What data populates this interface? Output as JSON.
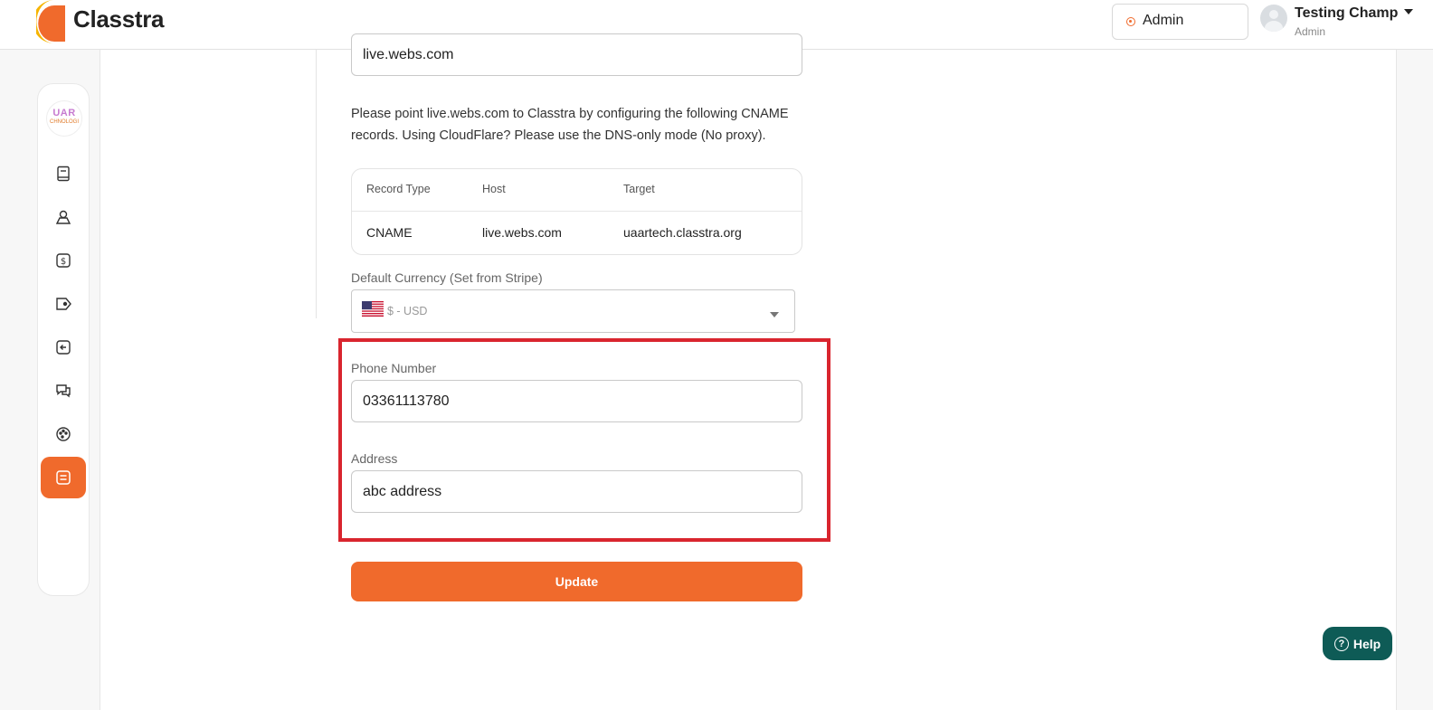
{
  "app": {
    "name": "Classtra"
  },
  "header": {
    "role_switch": {
      "label": "Admin"
    },
    "user": {
      "name": "Testing Champ",
      "role": "Admin"
    }
  },
  "sidebar": {
    "org_logo": {
      "line1": "UAR",
      "line2": "CHNOLOGI"
    },
    "items": [
      {
        "icon": "book-icon",
        "active": false
      },
      {
        "icon": "users-icon",
        "active": false
      },
      {
        "icon": "dollar-icon",
        "active": false
      },
      {
        "icon": "tag-icon",
        "active": false
      },
      {
        "icon": "logout-icon",
        "active": false
      },
      {
        "icon": "chat-icon",
        "active": false
      },
      {
        "icon": "palette-icon",
        "active": false
      },
      {
        "icon": "settings-list-icon",
        "active": true
      }
    ]
  },
  "settings": {
    "domain_value": "live.webs.com",
    "cname_instructions": "Please point live.webs.com to Classtra by configuring the following CNAME records. Using CloudFlare? Please use the DNS-only mode (No proxy).",
    "dns_table": {
      "columns": [
        "Record Type",
        "Host",
        "Target"
      ],
      "rows": [
        [
          "CNAME",
          "live.webs.com",
          "uaartech.classtra.org"
        ]
      ]
    },
    "currency": {
      "label": "Default Currency (Set from Stripe)",
      "value": "$ - USD",
      "flag": "us-flag-icon"
    },
    "phone": {
      "label": "Phone Number",
      "value": "03361113780"
    },
    "address": {
      "label": "Address",
      "value": "abc address"
    },
    "update_label": "Update"
  },
  "help": {
    "label": "Help"
  },
  "colors": {
    "accent": "#f06a2c",
    "highlight": "#d9252e",
    "help": "#0e5b56"
  }
}
